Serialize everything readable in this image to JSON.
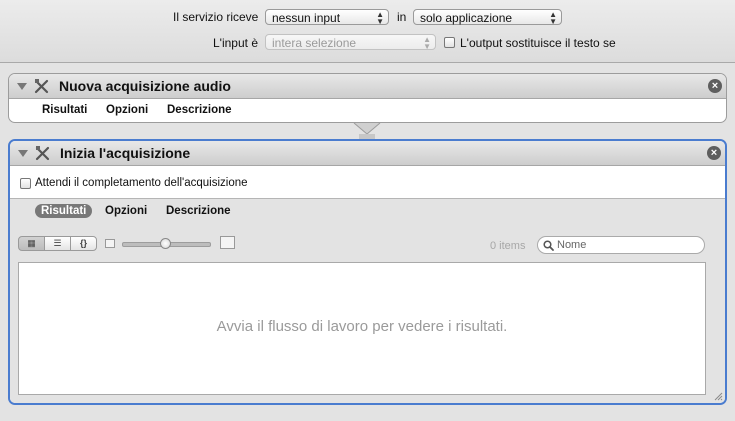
{
  "service_bar": {
    "receives_label": "Il servizio riceve",
    "input_type": "nessun input",
    "in_label": "in",
    "application": "solo applicazione",
    "input_is_label": "L'input è",
    "input_is_value": "intera selezione",
    "replaces_text_label": "L'output sostituisce il testo se"
  },
  "action1": {
    "title": "Nuova acquisizione audio",
    "tabs": [
      "Risultati",
      "Opzioni",
      "Descrizione"
    ]
  },
  "action2": {
    "title": "Inizia l'acquisizione",
    "wait_checkbox_label": "Attendi il completamento dell'acquisizione",
    "tabs": [
      "Risultati",
      "Opzioni",
      "Descrizione"
    ],
    "active_tab": "Risultati",
    "items_count": "0 items",
    "search_placeholder": "Nome",
    "empty_message": "Avvia il flusso di lavoro per vedere i risultati."
  },
  "icons": {
    "close": "close-icon",
    "tool": "tool-icon",
    "search": "search-icon",
    "grid_view": "grid-view-icon",
    "list_view": "list-view-icon",
    "code_view": "code-view-icon"
  },
  "colors": {
    "selection_border": "#4a7ccf",
    "header_gradient_top": "#e8e8e8",
    "header_gradient_bottom": "#cdcdcd"
  }
}
